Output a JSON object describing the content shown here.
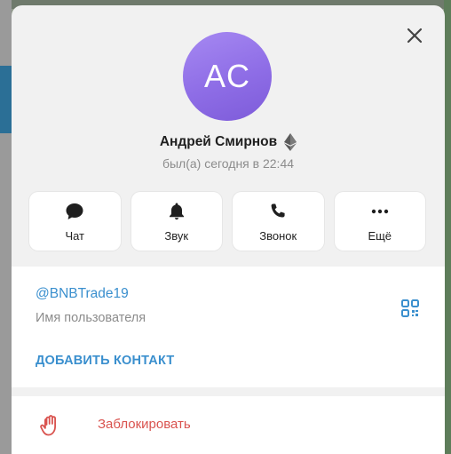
{
  "profile": {
    "avatar_initials": "AC",
    "avatar_color": "#8e6de6",
    "name": "Андрей Смирнов",
    "badge_icon": "ethereum-icon",
    "status": "был(а) сегодня в 22:44"
  },
  "actions": [
    {
      "label": "Чат",
      "icon": "chat-bubble-icon"
    },
    {
      "label": "Звук",
      "icon": "bell-icon"
    },
    {
      "label": "Звонок",
      "icon": "phone-icon"
    },
    {
      "label": "Ещё",
      "icon": "more-dots-icon"
    }
  ],
  "info": {
    "username": "@BNBTrade19",
    "username_caption": "Имя пользователя",
    "add_contact_label": "ДОБАВИТЬ КОНТАКТ",
    "qr_icon": "qr-code-icon"
  },
  "block": {
    "label": "Заблокировать",
    "icon": "hand-stop-icon",
    "color": "#d9534f"
  },
  "colors": {
    "accent": "#3a8fce",
    "danger": "#d9534f"
  }
}
